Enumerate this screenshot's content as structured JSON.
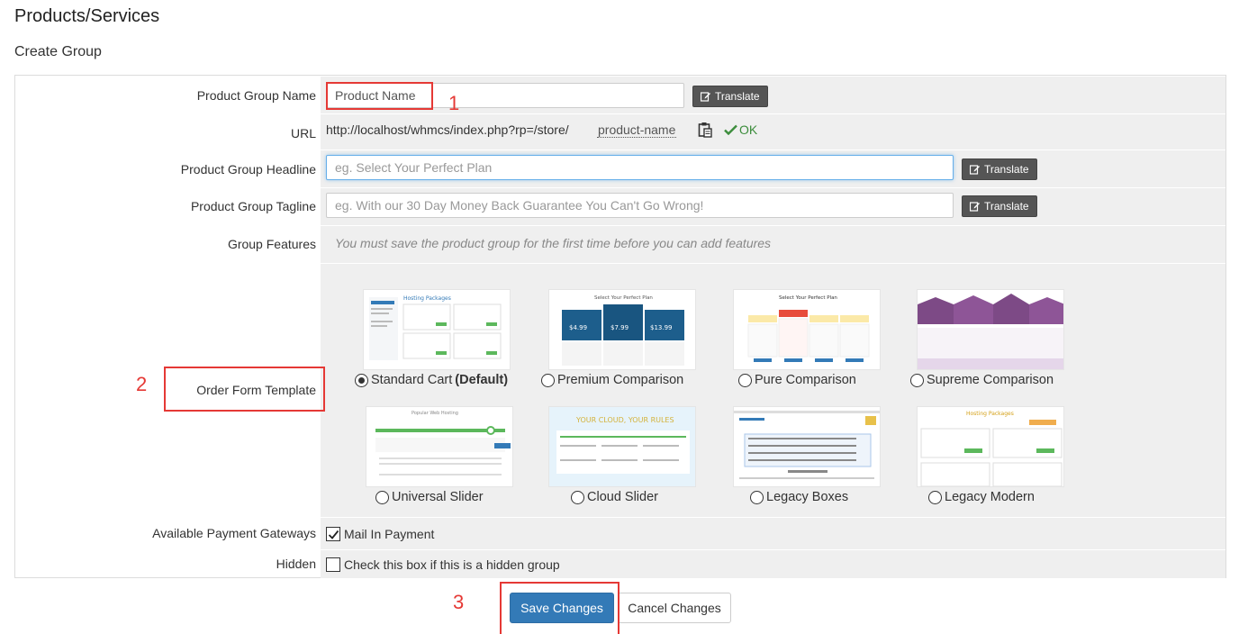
{
  "page": {
    "title": "Products/Services",
    "section": "Create Group"
  },
  "form": {
    "name": {
      "label": "Product Group Name",
      "value": "Product Name",
      "translate": "Translate"
    },
    "url": {
      "label": "URL",
      "base": "http://localhost/whmcs/index.php?rp=/store/",
      "slug": "product-name",
      "status": "OK"
    },
    "headline": {
      "label": "Product Group Headline",
      "placeholder": "eg. Select Your Perfect Plan",
      "translate": "Translate"
    },
    "tagline": {
      "label": "Product Group Tagline",
      "placeholder": "eg. With our 30 Day Money Back Guarantee You Can't Go Wrong!",
      "translate": "Translate"
    },
    "features": {
      "label": "Group Features",
      "note": "You must save the product group for the first time before you can add features"
    },
    "template": {
      "label": "Order Form Template",
      "selected": "Standard Cart",
      "options": [
        {
          "name": "Standard Cart",
          "suffix": "(Default)"
        },
        {
          "name": "Premium Comparison"
        },
        {
          "name": "Pure Comparison"
        },
        {
          "name": "Supreme Comparison"
        },
        {
          "name": "Universal Slider"
        },
        {
          "name": "Cloud Slider"
        },
        {
          "name": "Legacy Boxes"
        },
        {
          "name": "Legacy Modern"
        }
      ]
    },
    "gateways": {
      "label": "Available Payment Gateways",
      "option": "Mail In Payment",
      "checked": true
    },
    "hidden": {
      "label": "Hidden",
      "option": "Check this box if this is a hidden group",
      "checked": false
    }
  },
  "actions": {
    "save": "Save Changes",
    "cancel": "Cancel Changes"
  },
  "annotations": {
    "step1": "1",
    "step2": "2",
    "step3": "3",
    "color": "#e53935"
  },
  "colors": {
    "primary": "#337ab7",
    "ok": "#3c8d3c",
    "row_bg": "#efefef",
    "translate_bg": "#555555"
  }
}
